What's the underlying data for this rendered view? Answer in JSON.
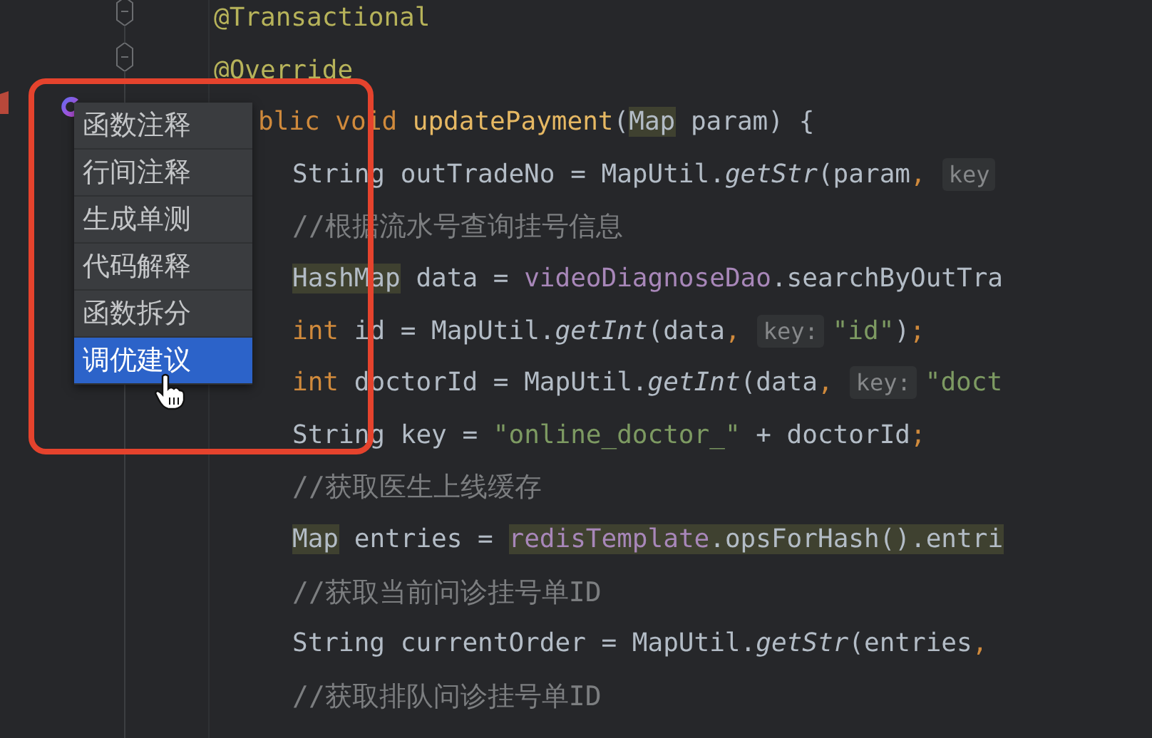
{
  "editor": {
    "lines": [
      {
        "kind": "member",
        "tokens": [
          {
            "text": "@Transactional",
            "kind": "annotation",
            "highlighted": false
          }
        ]
      },
      {
        "kind": "member",
        "tokens": [
          {
            "text": "@Override",
            "kind": "annotation",
            "highlighted": false
          }
        ]
      },
      {
        "kind": "member-covered",
        "tokens": [
          {
            "text": "blic void ",
            "kind": "keyword",
            "highlighted": false
          },
          {
            "text": "updatePayment",
            "kind": "function",
            "highlighted": false
          },
          {
            "text": "(",
            "kind": "plain",
            "highlighted": false
          },
          {
            "text": "Map",
            "kind": "plain",
            "highlighted": true
          },
          {
            "text": " param) {",
            "kind": "plain",
            "highlighted": false
          }
        ]
      },
      {
        "kind": "statement",
        "tokens": [
          {
            "text": "String outTradeNo = MapUtil.",
            "kind": "plain",
            "highlighted": false
          },
          {
            "text": "getStr",
            "kind": "call",
            "highlighted": false
          },
          {
            "text": "(param",
            "kind": "plain",
            "highlighted": false
          },
          {
            "text": ",",
            "kind": "punct",
            "highlighted": false
          },
          {
            "text": "key",
            "kind": "hint",
            "highlighted": false
          }
        ]
      },
      {
        "kind": "statement",
        "tokens": [
          {
            "text": "//根据流水号查询挂号信息",
            "kind": "comment",
            "highlighted": false
          }
        ]
      },
      {
        "kind": "statement",
        "tokens": [
          {
            "text": "HashMap",
            "kind": "plain",
            "highlighted": true
          },
          {
            "text": " data = ",
            "kind": "plain",
            "highlighted": false
          },
          {
            "text": "videoDiagnoseDao",
            "kind": "field",
            "highlighted": false
          },
          {
            "text": ".searchByOutTra",
            "kind": "plain",
            "highlighted": false
          }
        ]
      },
      {
        "kind": "statement",
        "tokens": [
          {
            "text": "int ",
            "kind": "keyword",
            "highlighted": false
          },
          {
            "text": "id = MapUtil.",
            "kind": "plain",
            "highlighted": false
          },
          {
            "text": "getInt",
            "kind": "call",
            "highlighted": false
          },
          {
            "text": "(data",
            "kind": "plain",
            "highlighted": false
          },
          {
            "text": ",",
            "kind": "punct",
            "highlighted": false
          },
          {
            "text": "key:",
            "kind": "hint",
            "highlighted": false
          },
          {
            "text": "\"id\"",
            "kind": "string",
            "highlighted": false
          },
          {
            "text": ")",
            "kind": "plain",
            "highlighted": false
          },
          {
            "text": ";",
            "kind": "punct",
            "highlighted": false
          }
        ]
      },
      {
        "kind": "statement",
        "tokens": [
          {
            "text": "int ",
            "kind": "keyword",
            "highlighted": false
          },
          {
            "text": "doctorId = MapUtil.",
            "kind": "plain",
            "highlighted": false
          },
          {
            "text": "getInt",
            "kind": "call",
            "highlighted": false
          },
          {
            "text": "(data",
            "kind": "plain",
            "highlighted": false
          },
          {
            "text": ",",
            "kind": "punct",
            "highlighted": false
          },
          {
            "text": "key:",
            "kind": "hint",
            "highlighted": false
          },
          {
            "text": "\"doct",
            "kind": "string",
            "highlighted": false
          }
        ]
      },
      {
        "kind": "statement",
        "tokens": [
          {
            "text": "String key = ",
            "kind": "plain",
            "highlighted": false
          },
          {
            "text": "\"online_doctor_\"",
            "kind": "string",
            "highlighted": false
          },
          {
            "text": " + doctorId",
            "kind": "plain",
            "highlighted": false
          },
          {
            "text": ";",
            "kind": "punct",
            "highlighted": false
          }
        ]
      },
      {
        "kind": "statement",
        "tokens": [
          {
            "text": "//获取医生上线缓存",
            "kind": "comment",
            "highlighted": false
          }
        ]
      },
      {
        "kind": "statement",
        "tokens": [
          {
            "text": "Map",
            "kind": "plain",
            "highlighted": true
          },
          {
            "text": " entries = ",
            "kind": "plain",
            "highlighted": false
          },
          {
            "text": "redisTemplate",
            "kind": "field",
            "highlighted": true
          },
          {
            "text": ".opsForHash().entri",
            "kind": "plain",
            "highlighted": true
          }
        ]
      },
      {
        "kind": "statement",
        "tokens": [
          {
            "text": "//获取当前问诊挂号单ID",
            "kind": "comment",
            "highlighted": false
          }
        ]
      },
      {
        "kind": "statement",
        "tokens": [
          {
            "text": "String currentOrder = MapUtil.",
            "kind": "plain",
            "highlighted": false
          },
          {
            "text": "getStr",
            "kind": "call",
            "highlighted": false
          },
          {
            "text": "(entries",
            "kind": "plain",
            "highlighted": false
          },
          {
            "text": ",",
            "kind": "punct",
            "highlighted": false
          }
        ]
      },
      {
        "kind": "statement",
        "tokens": [
          {
            "text": "//获取排队问诊挂号单ID",
            "kind": "comment",
            "highlighted": false
          }
        ]
      }
    ]
  },
  "popup": {
    "items": [
      {
        "label": "函数注释",
        "selected": false
      },
      {
        "label": "行间注释",
        "selected": false
      },
      {
        "label": "生成单测",
        "selected": false
      },
      {
        "label": "代码解释",
        "selected": false
      },
      {
        "label": "函数拆分",
        "selected": false
      },
      {
        "label": "调优建议",
        "selected": true
      }
    ]
  }
}
